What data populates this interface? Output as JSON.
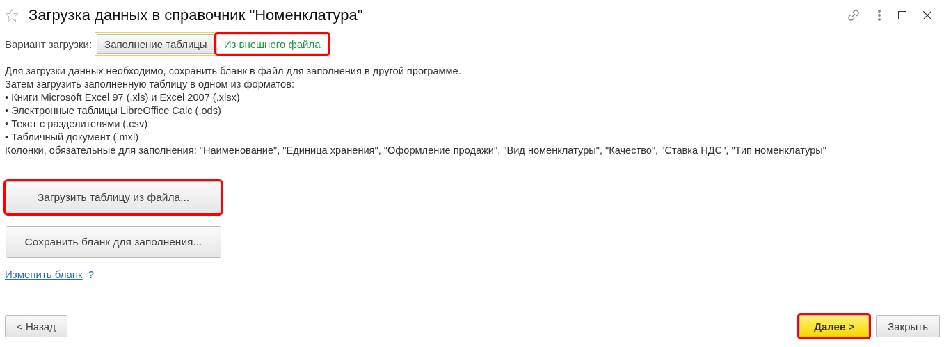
{
  "window": {
    "title": "Загрузка данных в справочник \"Номенклатура\"",
    "favorite": false
  },
  "load_mode": {
    "label": "Вариант загрузки:",
    "options": [
      {
        "label": "Заполнение таблицы",
        "selected": false,
        "highlighted": false
      },
      {
        "label": "Из внешнего файла",
        "selected": true,
        "highlighted": true
      }
    ]
  },
  "instructions": [
    "Для загрузки данных необходимо, сохранить бланк в файл для заполнения в другой программе.",
    "Затем загрузить заполненную таблицу в одном из форматов:",
    "• Книги Microsoft Excel 97 (.xls) и Excel 2007 (.xlsx)",
    "• Электронные таблицы LibreOffice Calc (.ods)",
    "• Текст с разделителями (.csv)",
    "• Табличный документ (.mxl)",
    "Колонки, обязательные для заполнения: \"Наименование\", \"Единица хранения\", \"Оформление продажи\", \"Вид номенклатуры\", \"Качество\", \"Ставка НДС\", \"Тип номенклатуры\""
  ],
  "actions": [
    {
      "label": "Загрузить таблицу из файла...",
      "highlighted": true
    },
    {
      "label": "Сохранить бланк для заполнения...",
      "highlighted": false
    }
  ],
  "change_link": {
    "label": "Изменить бланк",
    "help": "?"
  },
  "footer": {
    "back": {
      "label": "< Назад",
      "highlighted": false
    },
    "next": {
      "label": "Далее >",
      "highlighted": true
    },
    "close": {
      "label": "Закрыть",
      "highlighted": false
    }
  }
}
